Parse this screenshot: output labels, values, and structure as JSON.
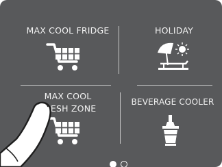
{
  "tiles": [
    {
      "label": "MAX COOL FRIDGE",
      "icon": "shopping-cart-icon"
    },
    {
      "label": "HOLIDAY",
      "icon": "beach-umbrella-icon"
    },
    {
      "label_line1": "MAX COOL",
      "label_line2": "FRESH ZONE",
      "icon": "shopping-cart-icon"
    },
    {
      "label": "BEVERAGE COOLER",
      "icon": "wine-bucket-icon"
    }
  ],
  "pager": {
    "pages": 2,
    "current": 1
  },
  "colors": {
    "panel": "#58595b",
    "text": "#f2f2f2",
    "divider": "#c9c9c9"
  }
}
